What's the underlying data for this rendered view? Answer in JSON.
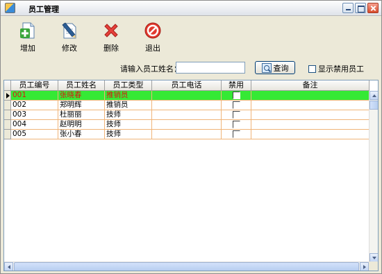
{
  "window": {
    "title": "员工管理"
  },
  "toolbar": [
    {
      "label": "增加",
      "icon": "add-icon"
    },
    {
      "label": "修改",
      "icon": "edit-icon"
    },
    {
      "label": "删除",
      "icon": "delete-icon"
    },
    {
      "label": "退出",
      "icon": "exit-icon"
    }
  ],
  "search": {
    "label": "请输入员工姓名：",
    "value": "",
    "button_label": "查询",
    "show_disabled_label": "显示禁用员工",
    "show_disabled_checked": false
  },
  "grid": {
    "columns": [
      "员工编号",
      "员工姓名",
      "员工类型",
      "员工电话",
      "禁用",
      "备注"
    ],
    "rows": [
      {
        "id": "001",
        "name": "张晓春",
        "type": "推销员",
        "phone": "",
        "disabled": false,
        "note": "",
        "selected": true
      },
      {
        "id": "002",
        "name": "郑明辉",
        "type": "推销员",
        "phone": "",
        "disabled": false,
        "note": "",
        "selected": false
      },
      {
        "id": "003",
        "name": "杜丽丽",
        "type": "技师",
        "phone": "",
        "disabled": false,
        "note": "",
        "selected": false
      },
      {
        "id": "004",
        "name": "赵明明",
        "type": "技师",
        "phone": "",
        "disabled": false,
        "note": "",
        "selected": false
      },
      {
        "id": "005",
        "name": "张小春",
        "type": "技师",
        "phone": "",
        "disabled": false,
        "note": "",
        "selected": false
      }
    ]
  },
  "colors": {
    "selected_row": "#35e935",
    "selected_text": "#dd1111",
    "grid_line": "#f0b478"
  }
}
